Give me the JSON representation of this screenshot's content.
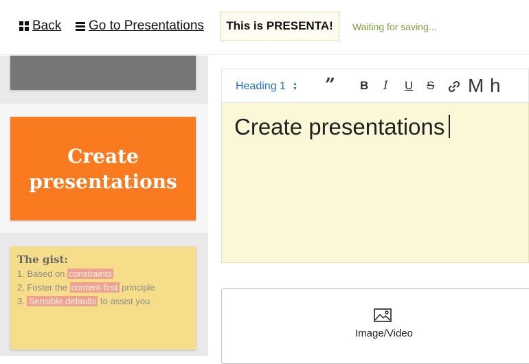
{
  "header": {
    "back_label": "Back",
    "presentations_label": "Go to Presentations",
    "title": "This is PRESENTA!",
    "save_status": "Waiting for saving..."
  },
  "slides": {
    "slide2_title": "Create presentations",
    "slide3": {
      "title": "The gist:",
      "items": [
        {
          "num": "1.",
          "before": "Based on",
          "highlight": "constraints",
          "after": ""
        },
        {
          "num": "2.",
          "before": "Foster the",
          "highlight": "content-first",
          "after": "principle"
        },
        {
          "num": "3.",
          "before": "",
          "highlight": "Sensible defaults",
          "after": "to assist you"
        }
      ]
    }
  },
  "toolbar": {
    "heading_select": "Heading 1",
    "quote_icon": "quote-icon",
    "bold": "B",
    "italic": "I",
    "underline": "U",
    "strike": "S",
    "link_icon": "link-icon",
    "m_label": "M",
    "h_label": "h"
  },
  "editor": {
    "content": "Create presentations"
  },
  "media": {
    "label": "Image/Video",
    "icon": "image-icon"
  },
  "colors": {
    "accent_orange": "#fa7a1f",
    "editor_bg": "#fbf8d8",
    "link_blue": "#1f6ec5",
    "status_green": "#7e9a3c"
  }
}
